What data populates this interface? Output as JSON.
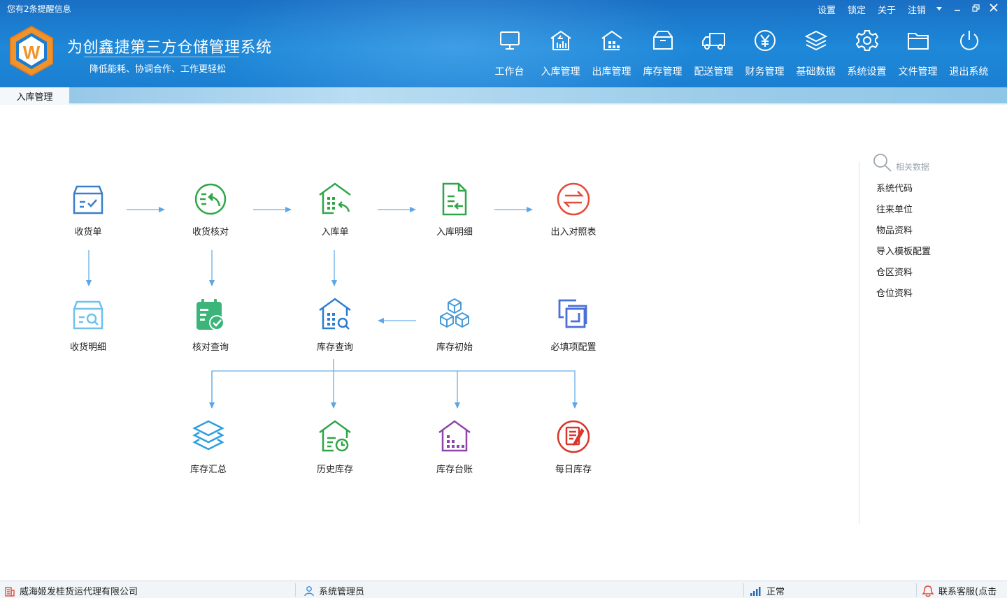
{
  "header": {
    "notice": "您有2条提醒信息",
    "title": "为创鑫捷第三方仓储管理系统",
    "subtitle": "降低能耗、协调合作、工作更轻松",
    "logo_letter": "W",
    "top_links": [
      "设置",
      "锁定",
      "关于",
      "注销"
    ],
    "nav": [
      {
        "label": "工作台",
        "icon": "monitor-icon"
      },
      {
        "label": "入库管理",
        "icon": "inbound-warehouse-icon"
      },
      {
        "label": "出库管理",
        "icon": "outbound-warehouse-icon"
      },
      {
        "label": "库存管理",
        "icon": "inventory-box-icon"
      },
      {
        "label": "配送管理",
        "icon": "truck-icon"
      },
      {
        "label": "财务管理",
        "icon": "yen-icon"
      },
      {
        "label": "基础数据",
        "icon": "layers-icon"
      },
      {
        "label": "系统设置",
        "icon": "gear-icon"
      },
      {
        "label": "文件管理",
        "icon": "folder-icon"
      },
      {
        "label": "退出系统",
        "icon": "power-icon"
      }
    ]
  },
  "tab": {
    "active": "入库管理"
  },
  "flow": {
    "receipt": "收货单",
    "receipt_check": "收货核对",
    "inbound_order": "入库单",
    "inbound_detail": "入库明细",
    "io_compare": "出入对照表",
    "receipt_detail": "收货明细",
    "check_query": "核对查询",
    "stock_query": "库存查询",
    "stock_init": "库存初始",
    "required_config": "必填项配置",
    "stock_summary": "库存汇总",
    "history_stock": "历史库存",
    "stock_ledger": "库存台账",
    "daily_stock": "每日库存"
  },
  "related": {
    "search_placeholder": "相关数据",
    "items": [
      "系统代码",
      "往来单位",
      "物品资料",
      "导入模板配置",
      "仓区资料",
      "仓位资料"
    ]
  },
  "statusbar": {
    "company": "威海姬发桂货运代理有限公司",
    "user": "系统管理员",
    "status": "正常",
    "support": "联系客服(点击"
  },
  "colors": {
    "header_blue": "#1e88d8",
    "flow_blue": "#3a7fc9",
    "flow_green": "#2fa548",
    "flow_red": "#e44b3a",
    "flow_purple": "#8e44ad",
    "arrow": "#6aaee6"
  }
}
